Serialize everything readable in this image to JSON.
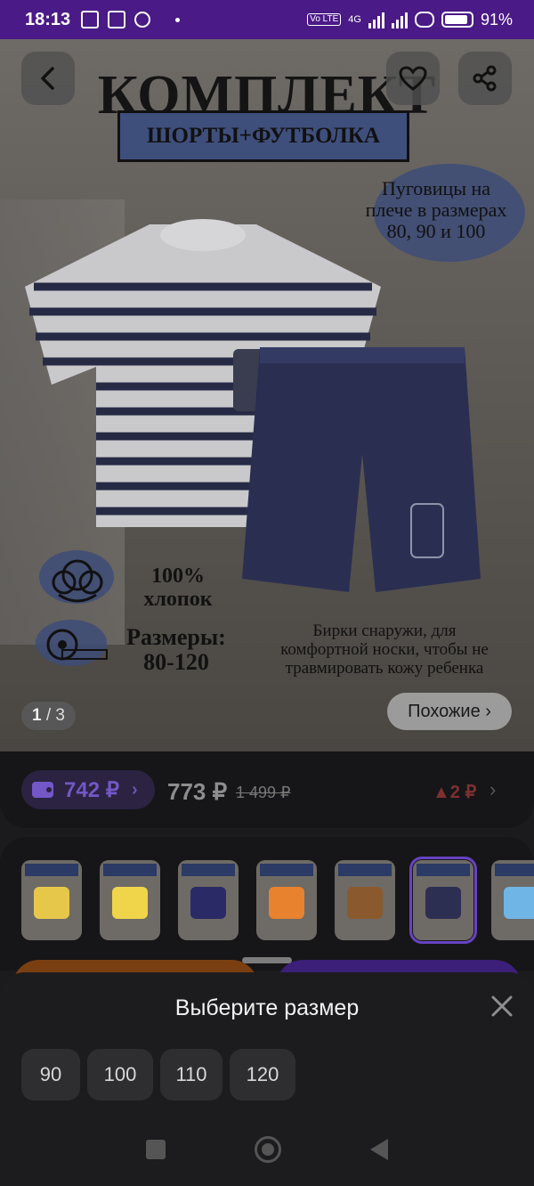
{
  "status_bar": {
    "time": "18:13",
    "network": "4G",
    "volte": "Vo LTE",
    "battery": "91%"
  },
  "product_image": {
    "title": "КОМПЛЕКТ",
    "subtitle": "ШОРТЫ+ФУТБОЛКА",
    "note_buttons": "Пуговицы на плече в размерах 80, 90 и 100",
    "note_cotton": "100% хлопок",
    "note_sizes": "Размеры: 80-120",
    "note_tags": "Бирки снаружи, для комфортной носки, чтобы не травмировать кожу ребенка",
    "counter_current": "1",
    "counter_total": "/ 3",
    "similar_label": "Похожие ›"
  },
  "price": {
    "wallet_price": "742 ₽",
    "current_price": "773 ₽",
    "old_price": "1 499 ₽",
    "change": "▲2 ₽"
  },
  "variants": [
    {
      "color": "#e7c74a"
    },
    {
      "color": "#f0d54a"
    },
    {
      "color": "#2a2b66"
    },
    {
      "color": "#e8822e"
    },
    {
      "color": "#8a5a2e"
    },
    {
      "color": "#2c2f52",
      "selected": true
    },
    {
      "color": "#6fb6e6"
    }
  ],
  "size_sheet": {
    "title": "Выберите размер",
    "sizes": [
      "90",
      "100",
      "110",
      "120"
    ]
  },
  "colors": {
    "accent": "#6743c2",
    "status_bar": "#4a1a86",
    "cta_orange": "#7a3f10",
    "cta_purple": "#3b1f78"
  }
}
